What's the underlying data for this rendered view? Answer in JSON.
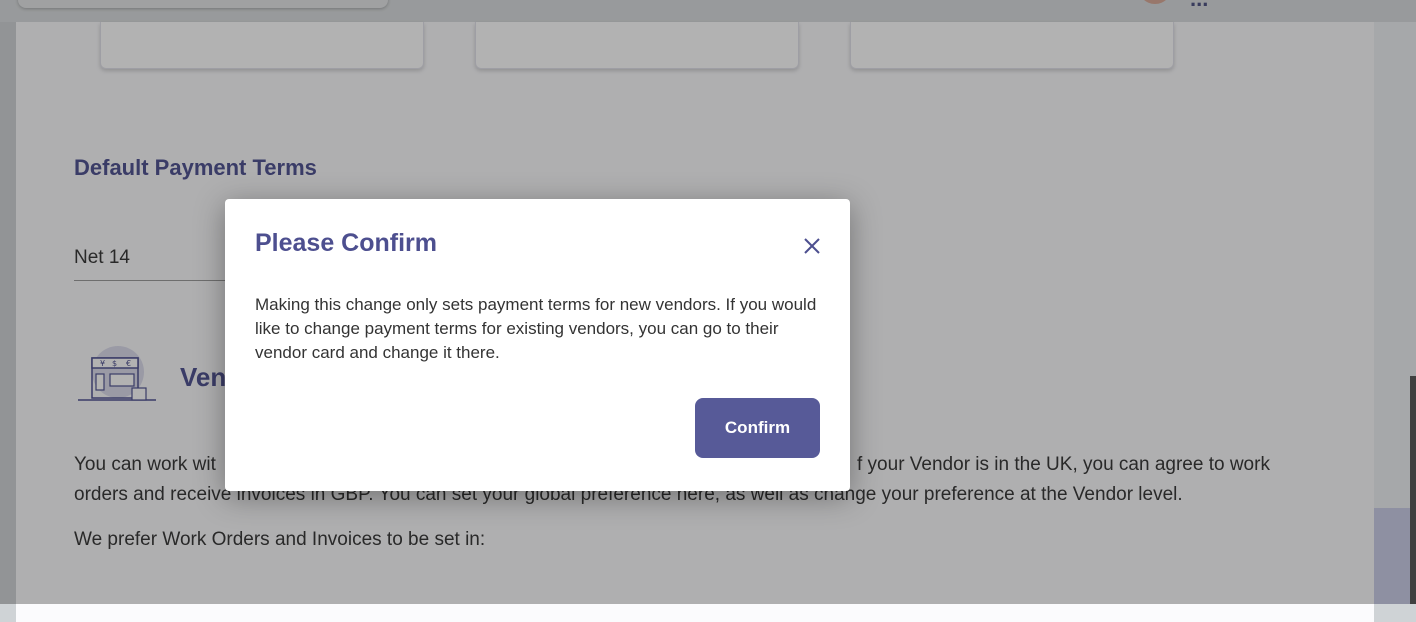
{
  "header": {
    "user_name": "..."
  },
  "settings": {
    "payment_terms_title": "Default Payment Terms",
    "payment_terms_value": "Net 14",
    "vendor_section_heading": "Ven",
    "currency_paragraph_line1_start": "You can work wit",
    "currency_paragraph_line1_end": "f your Vendor is in the UK, you can agree to work",
    "currency_paragraph_line2": "orders and receive invoices in GBP. You can set your global preference here, as well as change your preference at the Vendor level.",
    "currency_prompt": "We prefer Work Orders and Invoices to be set in:"
  },
  "modal": {
    "title": "Please Confirm",
    "body": "Making this change only sets payment terms for new vendors. If you would like to change payment terms for existing vendors, you can go to their vendor card and change it there.",
    "confirm_label": "Confirm",
    "close_icon": "close-icon"
  },
  "colors": {
    "accent": "#4d4f8f",
    "button": "#575a98",
    "overlay": "rgba(20,20,20,0.33)"
  }
}
